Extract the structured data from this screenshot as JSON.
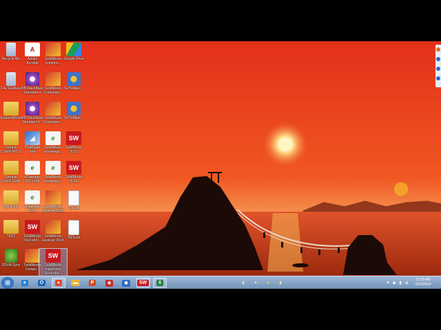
{
  "desktop": {
    "icons": [
      {
        "label": "Recycle Bin",
        "kind": "bin",
        "glyph": ""
      },
      {
        "label": "Adobe\nAcrobat",
        "kind": "pdf",
        "glyph": "A"
      },
      {
        "label": "SolidWorks\nCompos...",
        "kind": "swc",
        "glyph": ""
      },
      {
        "label": "Google Drive",
        "kind": "gd",
        "glyph": ""
      },
      {
        "label": "File Sanitizer",
        "kind": "bin",
        "glyph": ""
      },
      {
        "label": "BB FlashBack\nStandard 4",
        "kind": "flash",
        "glyph": ""
      },
      {
        "label": "SolidWorks\nComposer...",
        "kind": "swc",
        "glyph": ""
      },
      {
        "label": "SolToMeet...",
        "kind": "solt",
        "glyph": ""
      },
      {
        "label": "FeatureWorks",
        "kind": "folder",
        "glyph": ""
      },
      {
        "label": "BB FlashBack\nStandard 4...",
        "kind": "flash",
        "glyph": ""
      },
      {
        "label": "SolidWorks\nComposer...",
        "kind": "swc",
        "glyph": ""
      },
      {
        "label": "SolToMeet...",
        "kind": "solt",
        "glyph": ""
      },
      {
        "label": "Sample\nCSWP-MTLS",
        "kind": "folder",
        "glyph": ""
      },
      {
        "label": "DraftSight\nx64",
        "kind": "dsight",
        "glyph": "◢"
      },
      {
        "label": "SolidWorks\neDrawings...",
        "kind": "ed",
        "glyph": "e"
      },
      {
        "label": "SolidWorks\n2013",
        "kind": "sw",
        "glyph": "SW"
      },
      {
        "label": "Sample\nCSWP-SURF",
        "kind": "folder",
        "glyph": ""
      },
      {
        "label": "eDrawings\n2013 x64",
        "kind": "ed",
        "glyph": "e"
      },
      {
        "label": "SolidWorks\neDrawings...",
        "kind": "ed",
        "glyph": "e"
      },
      {
        "label": "SolidWorks\n2014",
        "kind": "sw",
        "glyph": "SW"
      },
      {
        "label": "SW Parts",
        "kind": "folder",
        "glyph": ""
      },
      {
        "label": "eDrawings\n2014",
        "kind": "ed",
        "glyph": "e"
      },
      {
        "label": "SolidWorks\nExplorer 2013",
        "kind": "swc",
        "glyph": ""
      },
      {
        "label": "List.txt",
        "kind": "doc",
        "glyph": ""
      },
      {
        "label": "TEST",
        "kind": "folder",
        "glyph": ""
      },
      {
        "label": "SolidWorks\n2014 x64 ...",
        "kind": "sw",
        "glyph": "SW"
      },
      {
        "label": "SolidWorks\nExplorer 2014",
        "kind": "swc",
        "glyph": ""
      },
      {
        "label": "ToDo.txt",
        "kind": "doc",
        "glyph": ""
      },
      {
        "label": "3DVIA Sync",
        "kind": "sync",
        "glyph": ""
      },
      {
        "label": "SolidWorks\nCompo...",
        "kind": "swc",
        "glyph": ""
      },
      {
        "label": "SolidWorks\nInspection\n2014 x64...",
        "kind": "sw",
        "glyph": "SW",
        "selected": true
      }
    ]
  },
  "taskbar": {
    "start_glyph": "⊞",
    "buttons": [
      {
        "name": "ie",
        "glyph": "e",
        "color": "#1f7fd6"
      },
      {
        "name": "outlook",
        "glyph": "O",
        "color": "#1d65b7"
      },
      {
        "name": "chrome",
        "glyph": "●",
        "color": "#e0452f",
        "active": true
      },
      {
        "name": "explorer",
        "glyph": "▬",
        "color": "#e6b73a"
      },
      {
        "name": "powerpoint",
        "glyph": "P",
        "color": "#d04b23"
      },
      {
        "name": "app",
        "glyph": "✲",
        "color": "#c22a2a"
      },
      {
        "name": "solidworks-composer",
        "glyph": "✱",
        "color": "#2e6ac2"
      },
      {
        "name": "solidworks",
        "glyph": "SW",
        "color": "#c8191e",
        "active": true
      },
      {
        "name": "excel",
        "glyph": "X",
        "color": "#1e7b3d",
        "active": true
      }
    ],
    "tray_mid": [
      "▮",
      "▲",
      "★",
      "▮"
    ],
    "tray_right": [
      "▲",
      "◆",
      "▮",
      "◂)"
    ],
    "clock": {
      "time": "11:59 AM",
      "date": "9/20/2014"
    }
  },
  "colors": {
    "sky_top": "#e8391c",
    "sky_mid": "#f15a22",
    "horizon": "#f7a05a",
    "sea": "#c83712",
    "sun": "#fff6c8",
    "silhouette": "#1c0a06"
  }
}
